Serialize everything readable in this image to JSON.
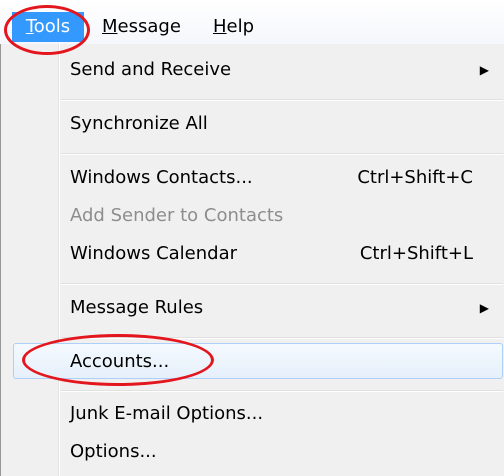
{
  "menubar": {
    "tools_label": "Tools",
    "message_label": "Message",
    "help_label": "Help"
  },
  "tools_menu": {
    "items": [
      {
        "label": "Send and Receive",
        "shortcut": "",
        "submenu": true,
        "enabled": true
      },
      {
        "label": "Synchronize All",
        "shortcut": "",
        "submenu": false,
        "enabled": true
      },
      {
        "label": "Windows Contacts...",
        "shortcut": "Ctrl+Shift+C",
        "submenu": false,
        "enabled": true
      },
      {
        "label": "Add Sender to Contacts",
        "shortcut": "",
        "submenu": false,
        "enabled": false
      },
      {
        "label": "Windows Calendar",
        "shortcut": "Ctrl+Shift+L",
        "submenu": false,
        "enabled": true
      },
      {
        "label": "Message Rules",
        "shortcut": "",
        "submenu": true,
        "enabled": true
      },
      {
        "label": "Accounts...",
        "shortcut": "",
        "submenu": false,
        "enabled": true,
        "highlighted": true
      },
      {
        "label": "Junk E-mail Options...",
        "shortcut": "",
        "submenu": false,
        "enabled": true
      },
      {
        "label": "Options...",
        "shortcut": "",
        "submenu": false,
        "enabled": true
      }
    ]
  },
  "colors": {
    "menubar_selected": "#3399ff",
    "annotation": "#e3161d",
    "disabled_text": "#8d8d8d",
    "highlight_border": "#aecff7"
  }
}
